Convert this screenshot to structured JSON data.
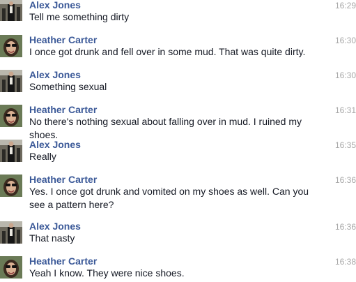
{
  "messages": [
    {
      "sender": "Alex Jones",
      "time": "16:29",
      "text": "Tell me something dirty",
      "avatar": "alex-avatar"
    },
    {
      "sender": "Heather Carter",
      "time": "16:30",
      "text": "I once got drunk and fell over in some mud. That was quite dirty.",
      "avatar": "heather-avatar"
    },
    {
      "sender": "Alex Jones",
      "time": "16:30",
      "text": "Something sexual",
      "avatar": "alex-avatar"
    },
    {
      "sender": "Heather Carter",
      "time": "16:31",
      "text": "No there's nothing sexual about falling over in mud. I ruined my shoes.",
      "avatar": "heather-avatar"
    },
    {
      "sender": "Alex Jones",
      "time": "16:35",
      "text": "Really",
      "avatar": "alex-avatar"
    },
    {
      "sender": "Heather Carter",
      "time": "16:36",
      "text": "Yes. I once got drunk and vomited on my shoes as well. Can you see a pattern here?",
      "avatar": "heather-avatar"
    },
    {
      "sender": "Alex Jones",
      "time": "16:36",
      "text": "That nasty",
      "avatar": "alex-avatar"
    },
    {
      "sender": "Heather Carter",
      "time": "16:38",
      "text": "Yeah I know. They were nice shoes.",
      "avatar": "heather-avatar"
    }
  ],
  "colors": {
    "sender": "#3b5998",
    "time": "#a7a7a7",
    "text": "#141823"
  }
}
